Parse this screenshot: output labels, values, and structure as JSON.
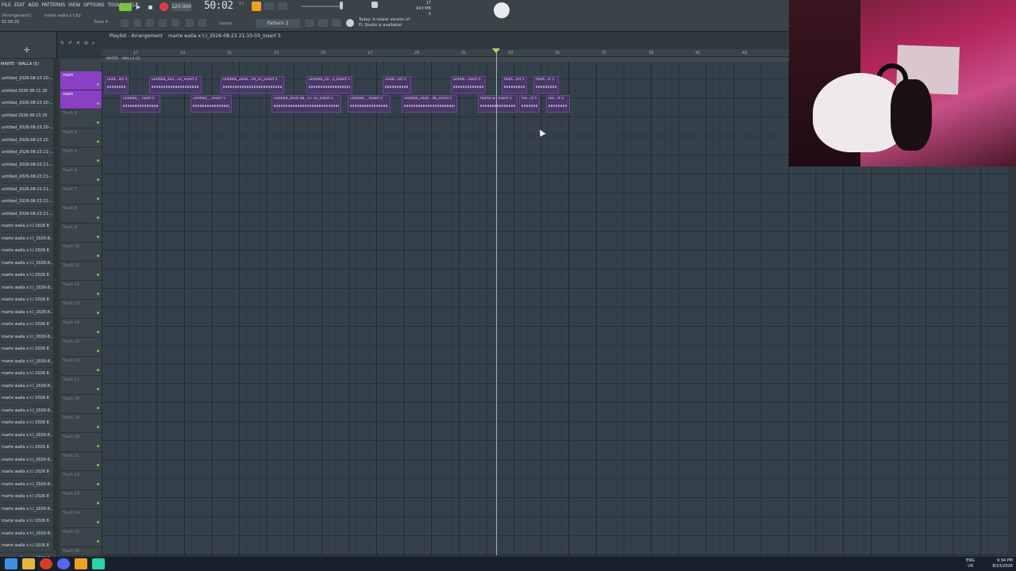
{
  "menu": [
    "FILE",
    "EDIT",
    "ADD",
    "PATTERNS",
    "VIEW",
    "OPTIONS",
    "TOOLS",
    "HELP"
  ],
  "project_file": "marte walla x t.flp",
  "hint": "(Arrangement)",
  "clock": "51:50:21",
  "tempo": "120.000",
  "song_time": "50:02",
  "song_time_sub": "17",
  "pattern_label": "Pattern 1",
  "none_label": "(none)",
  "track_label_top": "Track 4",
  "notice": [
    "Today: A newer version of",
    "FL Studio is available!"
  ],
  "cpu": [
    "17",
    "943 MB",
    "0"
  ],
  "playlist_title": "Playlist - Arrangement",
  "playlist_context": "marte walla x t.l_2026-08-23 21-33-03_Insert 5",
  "browser_title": "MARTE - WALLA (5)",
  "browser_items": [
    "untitled_2026-08-23 20-...",
    "untitled 2026 08 21 20",
    "untitled_2026-08-23 20-...",
    "untitled 2026 08 23 20",
    "untitled_2026-08-23 20-...",
    "untitled_2026-08-23 20",
    "untitled_2026-08-23 21-...",
    "untitled_2026-08-23 21-...",
    "untitled_2026-08-23 21-...",
    "untitled_2026-08-23 21-...",
    "untitled_2026-08-23 21-...",
    "untitled_2026-08-23 21-...",
    "marte walla x t.l 2026 8",
    "marte walla x t.l_2026-8...",
    "marte walla x t.l 2026 8",
    "marte walla x t.l_2026-8...",
    "marte walla x t.l 2026 8",
    "marte walla x t.l_2026-8...",
    "marte walla x t.l 2026 8",
    "marte walla x t.l_2026-8...",
    "marte walla x t.l 2026 8",
    "marte walla x t.l_2026-8...",
    "marte walla x t.l 2026 8",
    "marte walla x t.l_2026-8...",
    "marte walla x t.l 2026 8",
    "marte walla x t.l_2026-8...",
    "marte walla x t.l 2026 8",
    "marte walla x t.l_2026-8...",
    "marte walla x t.l 2026 8",
    "marte walla x t.l_2026-8...",
    "marte walla x t.l 2026 8",
    "marte walla x t.l_2026-8...",
    "marte walla x t.l 2026 8",
    "marte walla x t.l_2026-8...",
    "marte walla x t.l 2026 8",
    "marte walla x t.l_2026-8...",
    "marte walla x t.l 2026 8",
    "marte walla x t.l_2026-8...",
    "marte walla x t.l 2026 8",
    "marte walla x t.l_2026-8..."
  ],
  "ruler_marks": [
    "17",
    "",
    "19",
    "",
    "21",
    "",
    "23",
    "",
    "25",
    "",
    "27",
    "",
    "29",
    "",
    "31",
    "",
    "33",
    "",
    "35",
    "",
    "37",
    "",
    "39",
    "",
    "41",
    "",
    "43",
    "",
    "45",
    "",
    "47"
  ],
  "overview_label": "MARTE - WALLA (5)",
  "tracks": [
    {
      "label": "marti",
      "active": true
    },
    {
      "label": "marti",
      "active": true
    },
    {
      "label": "Track 3",
      "active": false
    },
    {
      "label": "Track 4",
      "active": false
    },
    {
      "label": "Track 5",
      "active": false
    },
    {
      "label": "Track 6",
      "active": false
    },
    {
      "label": "Track 7",
      "active": false
    },
    {
      "label": "Track 8",
      "active": false
    },
    {
      "label": "Track 9",
      "active": false
    },
    {
      "label": "Track 10",
      "active": false
    },
    {
      "label": "Track 11",
      "active": false
    },
    {
      "label": "Track 12",
      "active": false
    },
    {
      "label": "Track 13",
      "active": false
    },
    {
      "label": "Track 14",
      "active": false
    },
    {
      "label": "Track 15",
      "active": false
    },
    {
      "label": "Track 16",
      "active": false
    },
    {
      "label": "Track 17",
      "active": false
    },
    {
      "label": "Track 18",
      "active": false
    },
    {
      "label": "Track 19",
      "active": false
    },
    {
      "label": "Track 20",
      "active": false
    },
    {
      "label": "Track 21",
      "active": false
    },
    {
      "label": "Track 22",
      "active": false
    },
    {
      "label": "Track 23",
      "active": false
    },
    {
      "label": "Track 24",
      "active": false
    },
    {
      "label": "Track 25",
      "active": false
    },
    {
      "label": "Track 26",
      "active": false
    }
  ],
  "clips_row1": [
    "untit...ert 5",
    "untitled_202...21_Insert 5",
    "untitled_2026...59_21_Insert 5",
    "untitled_20...3_Insert 5",
    "untitl...ert 5",
    "untitle...nsert 5",
    "mart...ert 5",
    "mart...rt 5"
  ],
  "clips_row2": [
    "untitled_...nsert 5",
    "untitled_...Insert 5",
    "untitled_2026 08...57 32_Insert 5",
    "untitled_...Insert 5",
    "untitled_2026...46_Insert 5",
    "marte w...Insert 5",
    "ma...rt 5",
    "ma...rt 5"
  ],
  "taskbar": {
    "lang1": "ENG",
    "lang2": "US",
    "time": "9:34 PM",
    "date": "8/23/2026"
  }
}
